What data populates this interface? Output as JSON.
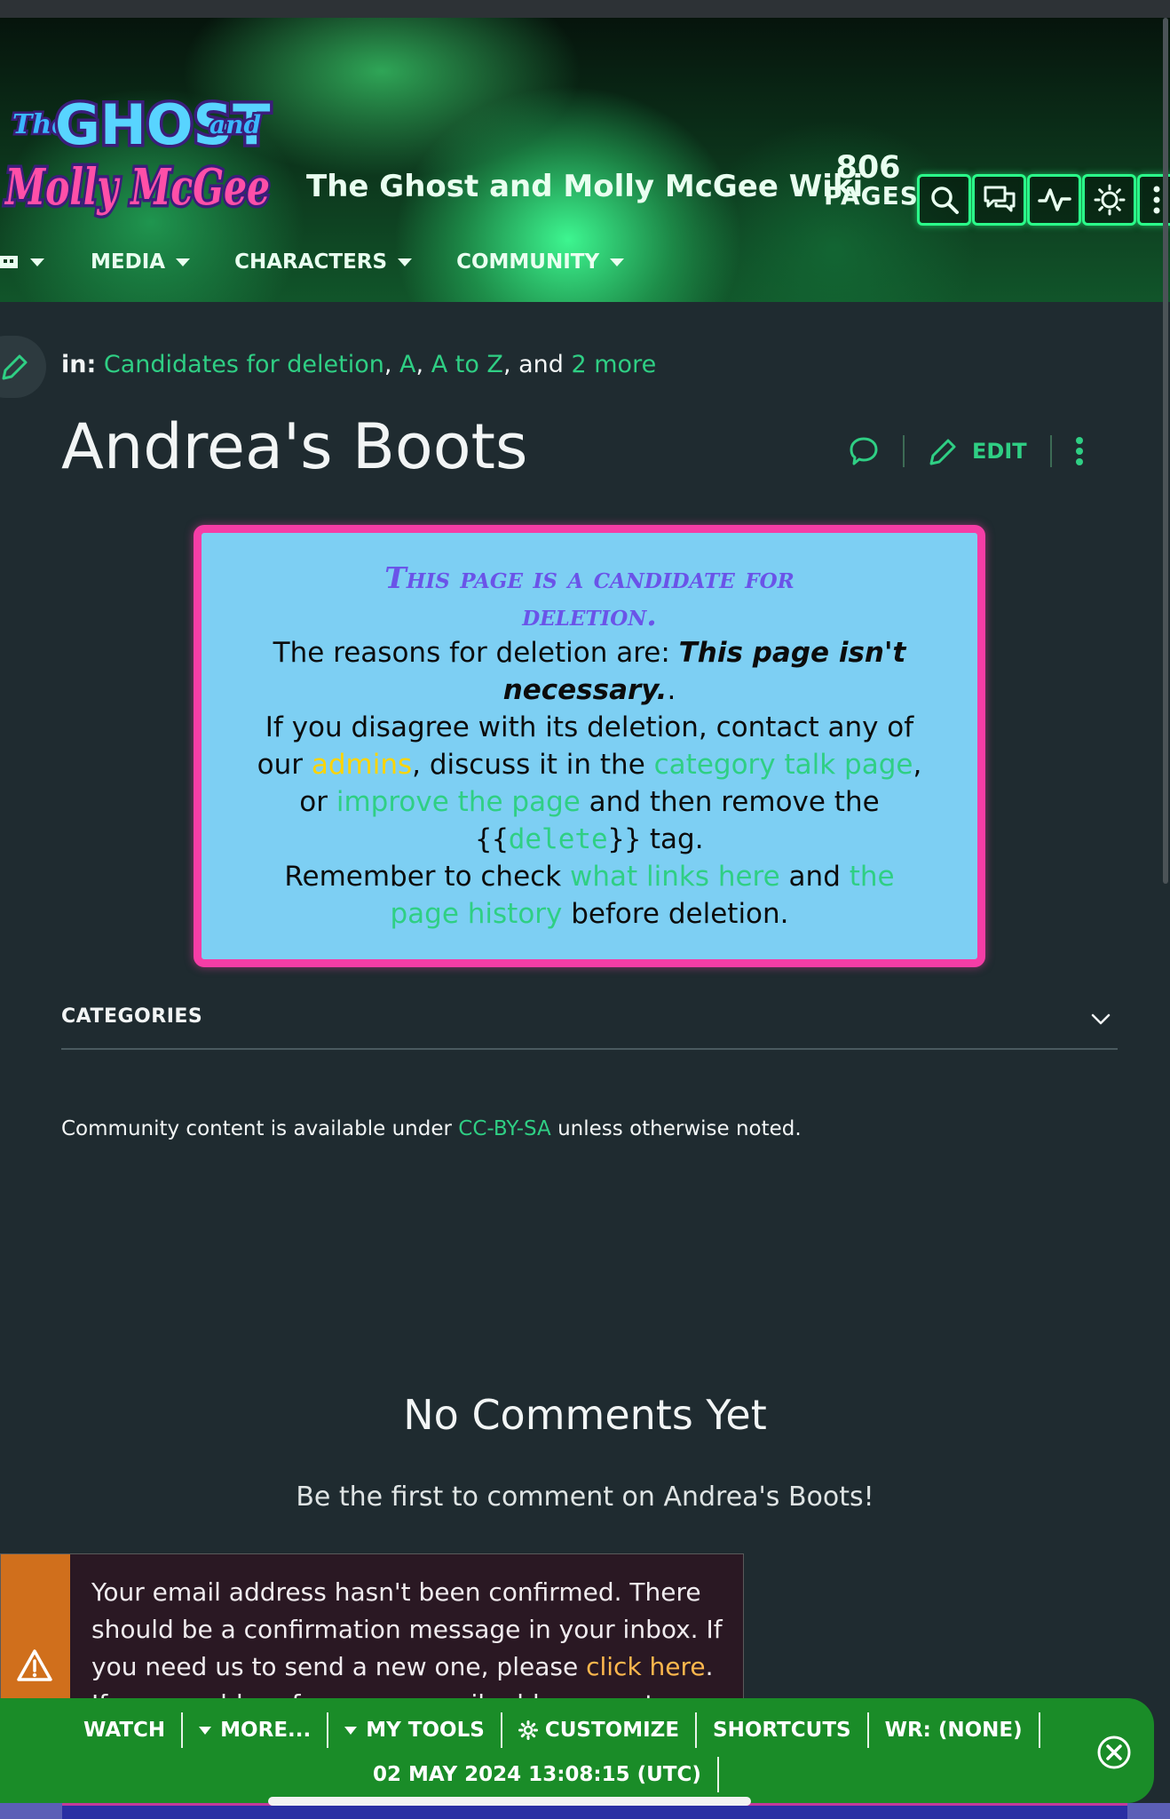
{
  "header": {
    "logo_line1_a": "The",
    "logo_line1_b": "GHOST",
    "logo_line1_c": "and",
    "logo_line2": "Molly McGee",
    "wiki_title": "The Ghost and Molly McGee Wiki",
    "pages_count": "806",
    "pages_label": "PAGES",
    "tools": [
      "search-icon",
      "discussions-icon",
      "activity-icon",
      "theme-icon",
      "more-icon"
    ]
  },
  "nav": {
    "items": [
      "MEDIA",
      "CHARACTERS",
      "COMMUNITY"
    ]
  },
  "article": {
    "in_label": "in:",
    "categories": [
      "Candidates for deletion",
      "A",
      "A to Z"
    ],
    "and_text": ", and",
    "more_link": "2 more",
    "title": "Andrea's Boots",
    "edit_label": "EDIT"
  },
  "delete_notice": {
    "heading": "This page is a candidate for deletion.",
    "reasons_prefix": "The reasons for deletion are: ",
    "reason": "This page isn't necessary.",
    "reason_suffix": ".",
    "disagree_1": "If you disagree with its deletion, contact any of our ",
    "admins_link": "admins",
    "disagree_2": ", discuss it in the ",
    "talk_link": "category talk page",
    "disagree_3": ", or ",
    "improve_link": "improve the page",
    "disagree_4": " and then remove the ",
    "tag_open": "{{",
    "tag_link": "delete",
    "tag_close": "}}",
    "disagree_5": " tag.",
    "remember_1": "Remember to check ",
    "links_here": "what links here",
    "remember_2": " and ",
    "history_link": "the page history",
    "remember_3": " before deletion."
  },
  "categories_section": {
    "label": "CATEGORIES"
  },
  "license": {
    "prefix": "Community content is available under ",
    "link": "CC-BY-SA",
    "suffix": " unless otherwise noted."
  },
  "comments": {
    "heading": "No Comments Yet",
    "subtext": "Be the first to comment on Andrea's Boots!"
  },
  "email_notice": {
    "text_1": "Your email address hasn't been confirmed. There should be a confirmation message in your inbox. If you need us to send a new one, please ",
    "link": "click here",
    "text_2": ". If you would prefer a new email address, go to Preferences."
  },
  "toolbar": {
    "watch": "WATCH",
    "more": "MORE...",
    "my_tools": "MY TOOLS",
    "customize": "CUSTOMIZE",
    "shortcuts": "SHORTCUTS",
    "wr": "WR: (NONE)",
    "timestamp": "02 MAY 2024 13:08:15 (UTC)"
  },
  "colors": {
    "accent": "#2fcf84",
    "background": "#1f2b30",
    "delete_box_bg": "#7dcff3",
    "delete_box_border": "#f53da6",
    "toolbar_bg": "#1a8c28",
    "notice_side": "#d06f1c"
  }
}
